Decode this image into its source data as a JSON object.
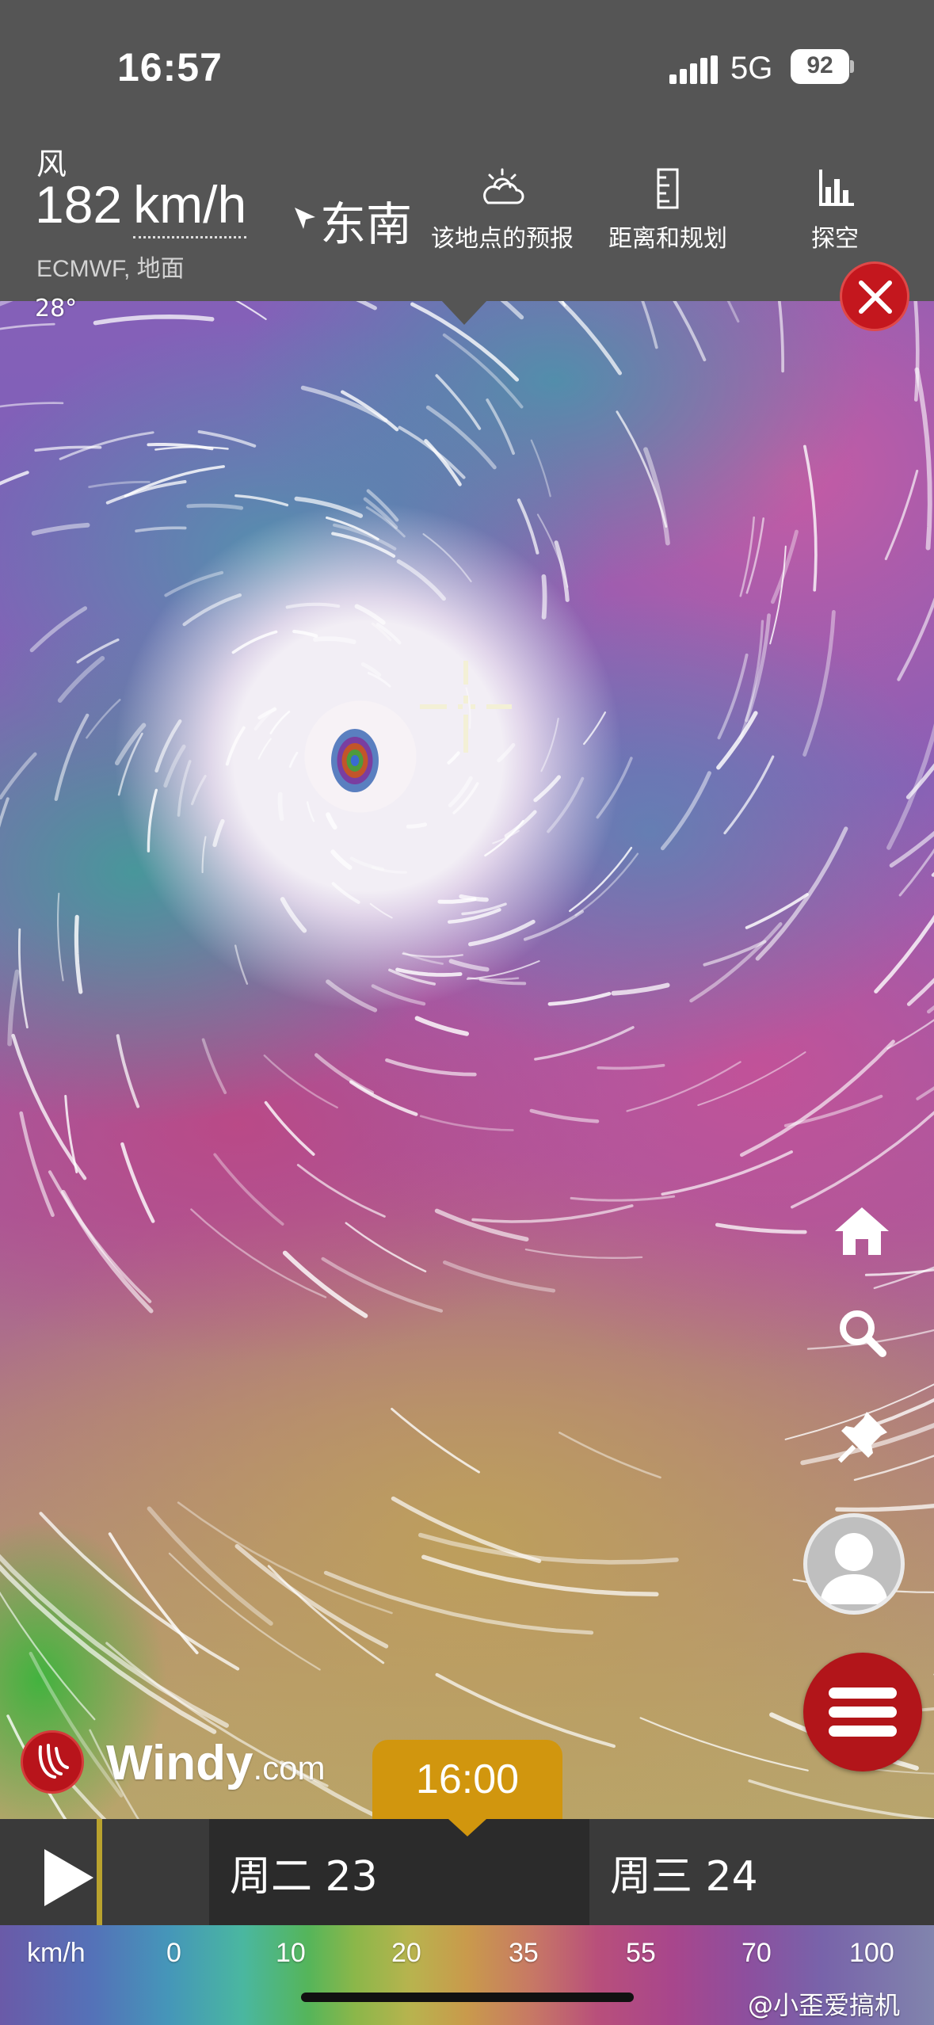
{
  "status_bar": {
    "time": "16:57",
    "network": "5G",
    "battery": "92"
  },
  "wind_panel": {
    "label": "风",
    "speed": "182",
    "unit": "km/h",
    "direction": "东南",
    "source": "ECMWF, 地面"
  },
  "tools": [
    {
      "label": "该地点的预报",
      "icon": "cloud-sun-icon"
    },
    {
      "label": "距离和规划",
      "icon": "ruler-icon"
    },
    {
      "label": "探空",
      "icon": "bar-chart-icon"
    }
  ],
  "map": {
    "latitude_label": "28°"
  },
  "brand": {
    "name": "Windy",
    "domain": ".com"
  },
  "time_selector": {
    "current_time": "16:00"
  },
  "timeline": {
    "days": [
      "周二 23",
      "周三 24"
    ]
  },
  "legend": {
    "unit": "km/h",
    "values": [
      "0",
      "10",
      "20",
      "35",
      "55",
      "70",
      "100"
    ]
  },
  "watermark": "@小歪爱搞机",
  "colors": {
    "accent_red": "#b2151a",
    "time_orange": "#d1960e",
    "panel_gray": "#555555"
  }
}
